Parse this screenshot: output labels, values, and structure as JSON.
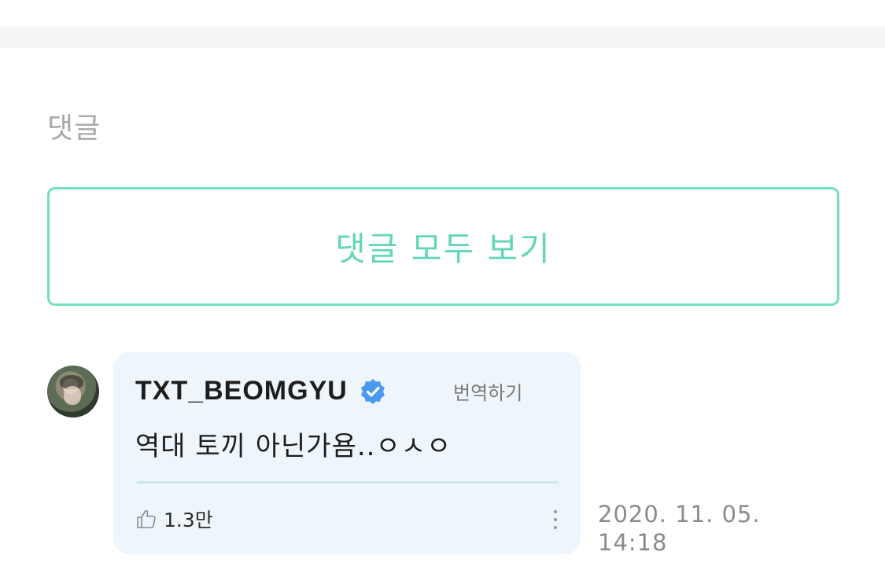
{
  "comments_section": {
    "title": "댓글",
    "view_all_label": "댓글 모두 보기"
  },
  "comment": {
    "author": "TXT_BEOMGYU",
    "translate_label": "번역하기",
    "text": "역대 토끼 아닌가욤..ㅇㅅㅇ",
    "like_count": "1.3만",
    "date_line1": "2020. 11. 05.",
    "date_line2": "14:18"
  },
  "icons": {
    "verified": "verified-badge-icon",
    "like": "thumbs-up-icon",
    "more": "more-vertical-icon"
  },
  "colors": {
    "accent": "#72dfc3",
    "accent_text": "#64d6b8",
    "verified_blue": "#4a98f0",
    "bubble_bg": "#eef6fc"
  }
}
